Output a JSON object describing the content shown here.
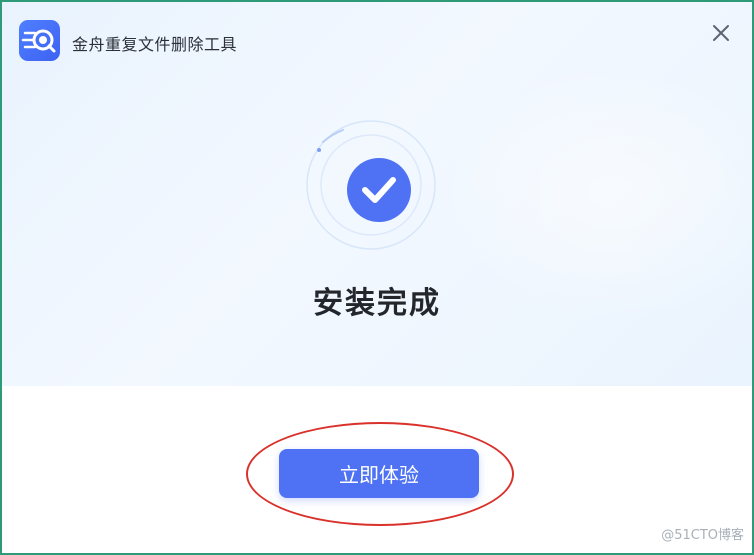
{
  "window": {
    "title": "金舟重复文件删除工具",
    "close_label": "×",
    "icons": {
      "app": "app-logo-icon",
      "close": "close-icon",
      "status": "checkmark-icon"
    }
  },
  "main": {
    "status_title": "安装完成",
    "primary_button_label": "立即体验"
  },
  "footer": {
    "watermark": "@51CTO博客"
  },
  "colors": {
    "accent": "#4f72f5",
    "highlight": "#d9322b",
    "background_top": "#eaf4fe",
    "window_border": "#2f9a78"
  }
}
